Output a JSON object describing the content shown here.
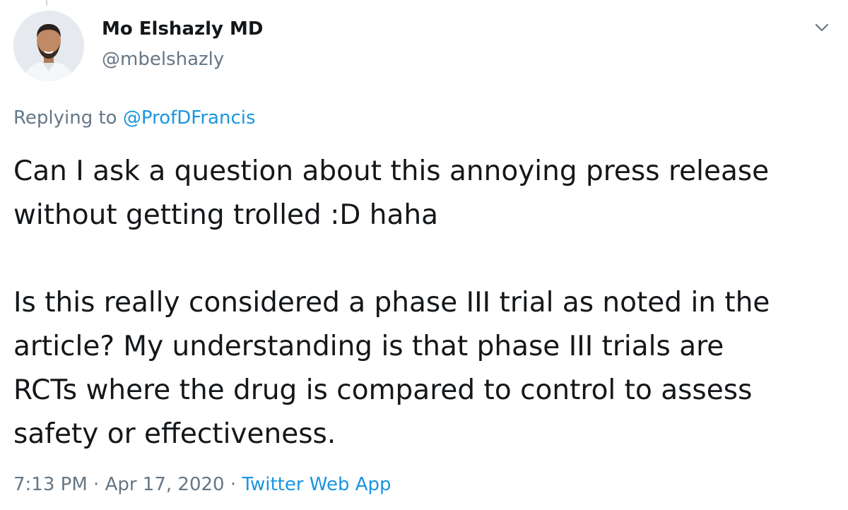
{
  "tweet": {
    "author": {
      "name": "Mo Elshazly MD",
      "handle": "@mbelshazly"
    },
    "reply": {
      "prefix": "Replying to",
      "mention": "@ProfDFrancis"
    },
    "text": {
      "line1": "Can I ask a question about this annoying press release",
      "line2": "without getting trolled :D haha",
      "line3": "Is this really considered a phase III trial as noted in the",
      "line4": "article? My understanding is that phase III trials are",
      "line5": "RCTs where the drug is compared to control to assess",
      "line6": "safety or effectiveness."
    },
    "meta": {
      "time": "7:13 PM",
      "separator": "·",
      "date": "Apr 17, 2020",
      "source": "Twitter Web App"
    }
  },
  "icons": {
    "menu": "chevron-down-icon",
    "avatar": "avatar"
  },
  "colors": {
    "primary_text": "#14171a",
    "secondary_text": "#657786",
    "link": "#1b95e0"
  }
}
